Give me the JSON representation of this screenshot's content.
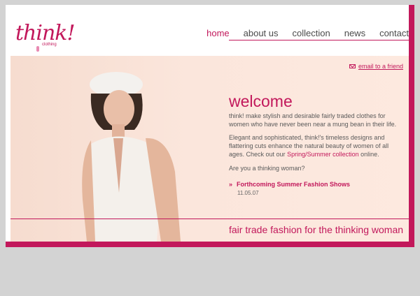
{
  "brand": {
    "name": "think!",
    "sub": "clothing"
  },
  "nav": {
    "items": [
      {
        "label": "home",
        "active": true
      },
      {
        "label": "about us",
        "active": false
      },
      {
        "label": "collection",
        "active": false
      },
      {
        "label": "news",
        "active": false
      },
      {
        "label": "contact",
        "active": false
      }
    ]
  },
  "hero": {
    "email_link": "email to a friend",
    "title": "welcome",
    "intro": "think! make stylish and desirable fairly traded clothes for women who have never been near a mung bean in their life.",
    "body_before": "Elegant and sophisticated, think!'s timeless designs and flattering cuts enhance the natural beauty of women of all ages. Check out our ",
    "collection_link": "Spring/Summer collection",
    "body_after": " online.",
    "question": "Are you a thinking woman?",
    "news_link": "Forthcoming Summer Fashion Shows",
    "news_date": "11.05.07",
    "tagline": "fair trade fashion for the thinking woman"
  },
  "colors": {
    "accent": "#c2185b",
    "hero_bg": "#fbe6dc",
    "page_bg": "#d3d3d3"
  }
}
